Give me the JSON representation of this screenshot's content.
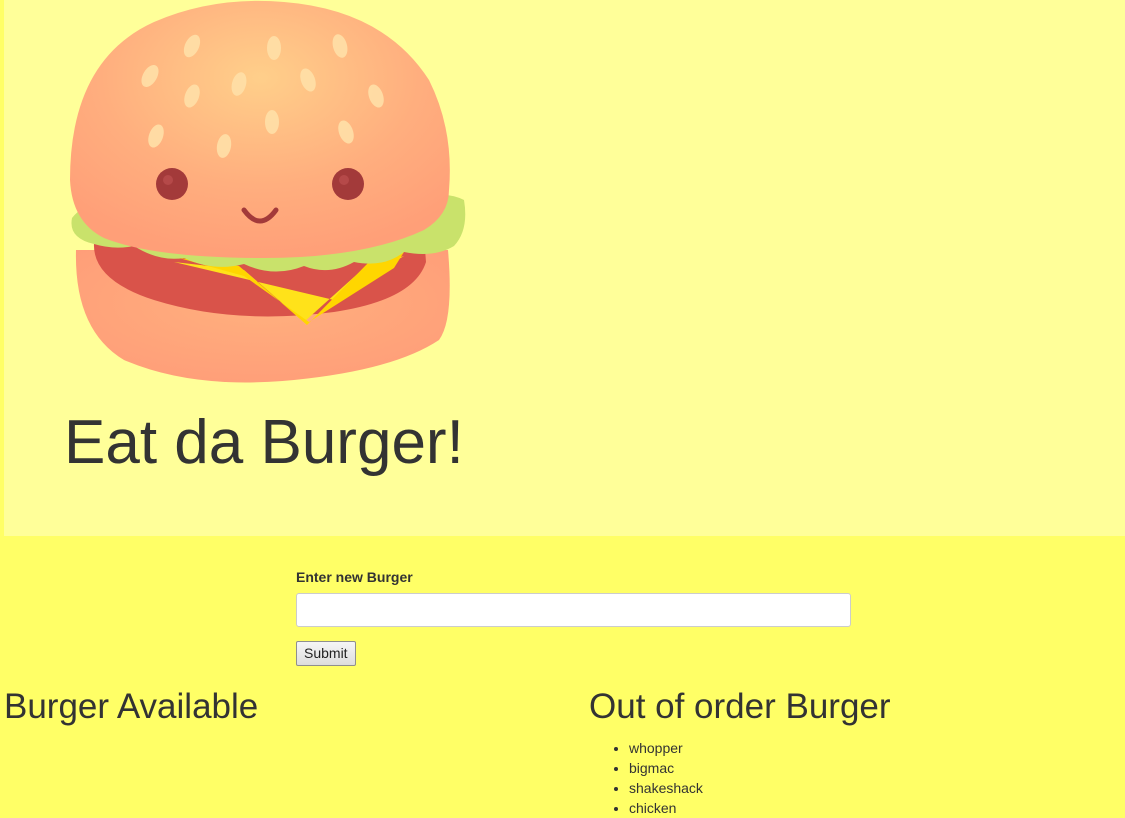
{
  "header": {
    "title": "Eat da Burger!"
  },
  "form": {
    "label": "Enter new Burger",
    "input_value": "",
    "input_placeholder": "",
    "submit_label": "Submit"
  },
  "available": {
    "heading": "Burger Available",
    "items": []
  },
  "devoured": {
    "heading": "Out of order Burger",
    "items": [
      "whopper",
      "bigmac",
      "shakeshack",
      "chicken"
    ]
  },
  "colors": {
    "page_background": "#ffff66",
    "jumbotron_background": "#ffff99",
    "text": "#333333"
  },
  "icons": {
    "logo": "kawaii-burger-icon"
  }
}
